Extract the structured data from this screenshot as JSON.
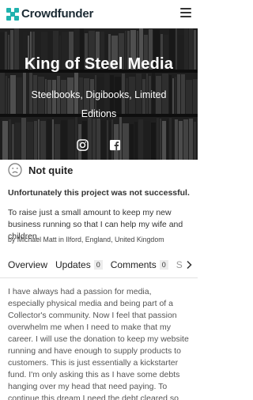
{
  "header": {
    "brand": "Crowdfunder",
    "logo_icon": "crowdfunder-logo-icon",
    "menu_icon": "hamburger-menu-icon"
  },
  "hero": {
    "title": "King of Steel Media",
    "subtitle": "Steelbooks, Digibooks, Limited Editions",
    "social": [
      "instagram-icon",
      "facebook-icon"
    ]
  },
  "status": {
    "icon": "sad-face-icon",
    "label": "Not quite"
  },
  "project": {
    "result": "Unfortunately this project was not successful.",
    "blurb": "To raise just a small amount to keep my new business running so that I can help my wife and children.",
    "byline": "by Michael Matt in Ilford, England, United Kingdom"
  },
  "tabs": {
    "overview": "Overview",
    "updates": "Updates",
    "updates_count": "0",
    "comments": "Comments",
    "comments_count": "0",
    "clipped": "S",
    "next_icon": "chevron-right-icon"
  },
  "description": "I have always had a passion for media, especially physical media and being part of a Collector's community. Now I feel that passion overwhelm me when I need to make that my career. I will use the donation to keep my website running and have enough to supply products to customers. This is just essentially a kickstarter fund. I'm only asking this as I have some debts hanging over my head that need paying. To continue this dream I need the debt cleared so that I can move forward.",
  "colors": {
    "accent": "#1fb2ae",
    "brand_text": "#1b2a33"
  }
}
